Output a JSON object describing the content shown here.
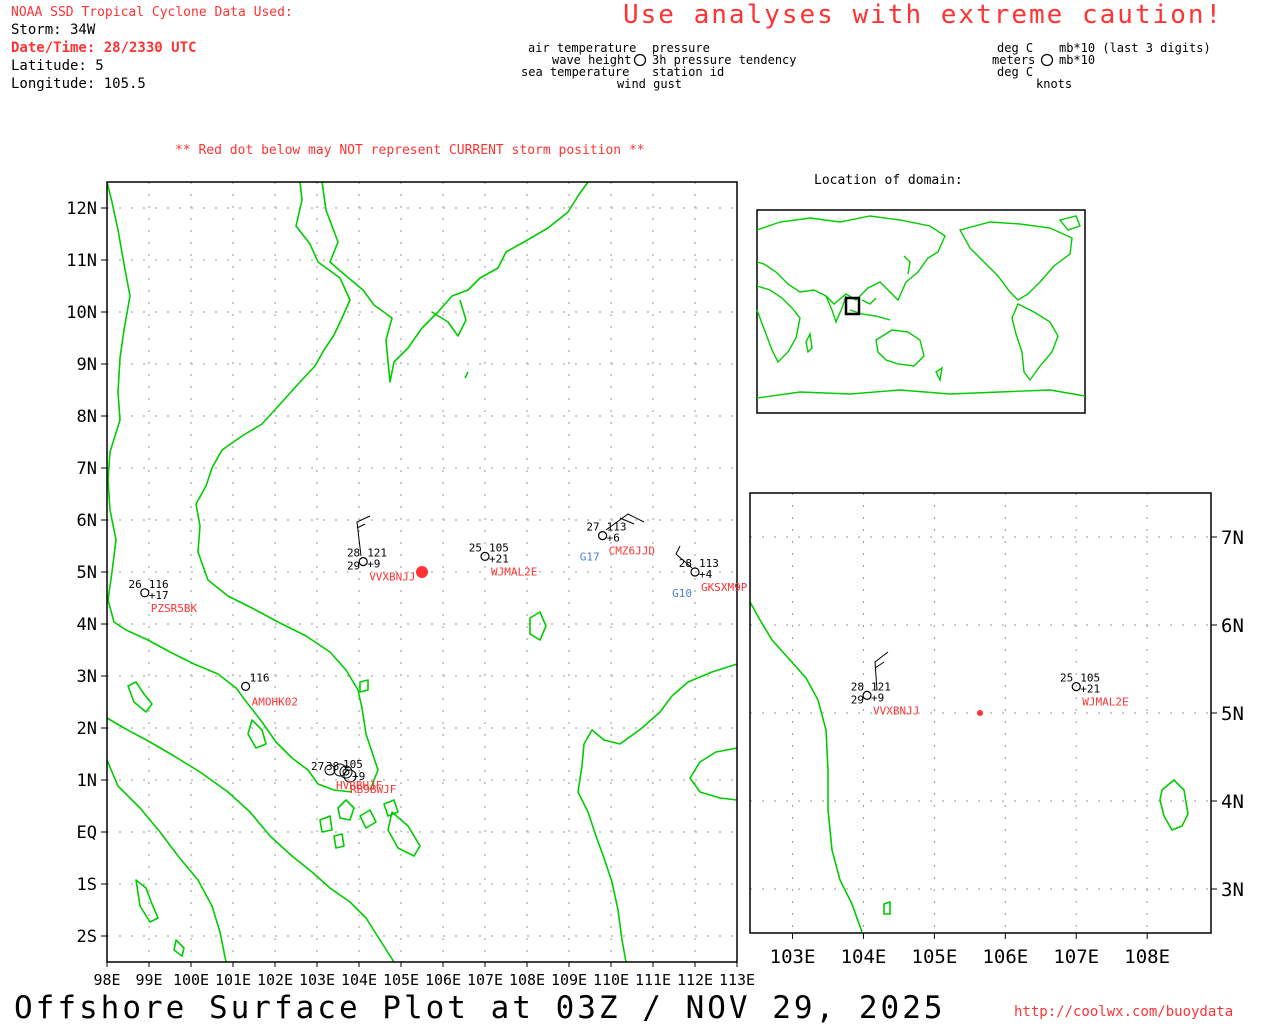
{
  "header": {
    "source": "NOAA SSD Tropical Cyclone Data Used:",
    "storm": "Storm: 34W",
    "datetime": "Date/Time: 28/2330 UTC",
    "latitude": "Latitude: 5",
    "longitude": "Longitude: 105.5",
    "caution": "Use analyses with extreme caution!"
  },
  "legend_left": {
    "air_temp": "air temperature",
    "wave_height": "wave height",
    "sea_temp": "sea temperature",
    "pressure": "pressure",
    "tendency": "3h pressure tendency",
    "station_id": "station id",
    "wind_gust": "wind gust"
  },
  "legend_right": {
    "deg_c_1": "deg C",
    "meters": "meters",
    "deg_c_2": "deg C",
    "mb_last3": "mb*10 (last 3 digits)",
    "mb": "mb*10",
    "knots": "knots"
  },
  "warning": "** Red dot below may NOT represent CURRENT storm position **",
  "inset_title": "Location of domain:",
  "main_map": {
    "lat_labels": [
      "12N",
      "11N",
      "10N",
      "9N",
      "8N",
      "7N",
      "6N",
      "5N",
      "4N",
      "3N",
      "2N",
      "1N",
      "EQ",
      "1S",
      "2S"
    ],
    "lon_labels": [
      "98E",
      "99E",
      "100E",
      "101E",
      "102E",
      "103E",
      "104E",
      "105E",
      "106E",
      "107E",
      "108E",
      "109E",
      "110E",
      "111E",
      "112E",
      "113E"
    ],
    "storm_lon": 105.5,
    "storm_lat": 5,
    "stations": [
      {
        "id": "VVXBNJJ",
        "lon": 104.1,
        "lat": 5.2,
        "air": "28",
        "sst": "29",
        "pres": "121",
        "tend": "+9",
        "gust": ""
      },
      {
        "id": "WJMAL2E",
        "lon": 107.0,
        "lat": 5.3,
        "air": "25",
        "sst": "",
        "pres": "105",
        "tend": "+21",
        "gust": ""
      },
      {
        "id": "CMZ6JJD",
        "lon": 109.8,
        "lat": 5.7,
        "air": "27",
        "sst": "",
        "pres": "113",
        "tend": "+6",
        "gust": "G17"
      },
      {
        "id": "GKSXM9P",
        "lon": 112.0,
        "lat": 5.0,
        "air": "28",
        "sst": "",
        "pres": "113",
        "tend": "+4",
        "gust": "G10"
      },
      {
        "id": "PZSR5BK",
        "lon": 98.9,
        "lat": 4.6,
        "air": "26",
        "sst": "",
        "pres": "116",
        "tend": "+17",
        "gust": ""
      },
      {
        "id": "AMOHK02",
        "lon": 101.3,
        "lat": 2.8,
        "air": "",
        "sst": "",
        "pres": "116",
        "tend": "",
        "gust": ""
      }
    ],
    "cluster": {
      "air": "27",
      "lon": 103.8,
      "lat": 1.2
    }
  },
  "zoom_map": {
    "lat_labels": [
      "7N",
      "6N",
      "5N",
      "4N",
      "3N"
    ],
    "lon_labels": [
      "103E",
      "104E",
      "105E",
      "106E",
      "107E",
      "108E"
    ],
    "stations": [
      {
        "id": "VVXBNJJ",
        "air": "28",
        "sst": "29",
        "pres": "121",
        "tend": "+9"
      },
      {
        "id": "WJMAL2E",
        "air": "25",
        "sst": "",
        "pres": "105",
        "tend": "+21"
      }
    ]
  },
  "footer": {
    "title": "Offshore Surface Plot at 03Z / NOV 29, 2025",
    "url": "http://coolwx.com/buoydata"
  },
  "colors": {
    "coast": "#00cc00",
    "accent": "#ff3333",
    "gust": "#4a7fd6",
    "grid": "#9a9a9a"
  }
}
